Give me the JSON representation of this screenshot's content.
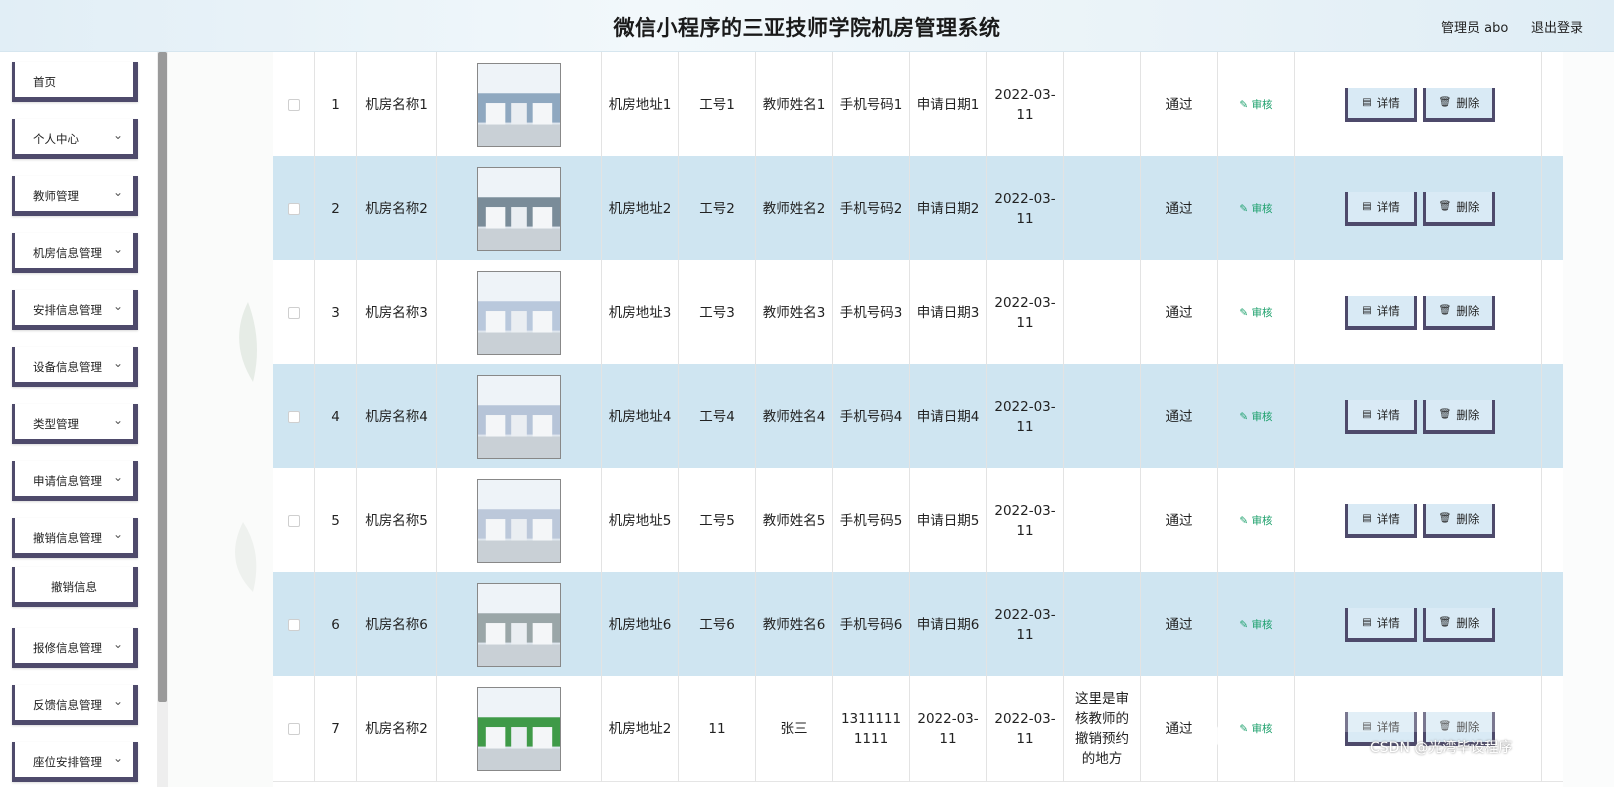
{
  "header": {
    "title": "微信小程序的三亚技师学院机房管理系统",
    "admin_label": "管理员 abo",
    "logout_label": "退出登录"
  },
  "sidebar": {
    "items": [
      {
        "label": "首页",
        "has_chevron": false
      },
      {
        "label": "个人中心",
        "has_chevron": true
      },
      {
        "label": "教师管理",
        "has_chevron": true
      },
      {
        "label": "机房信息管理",
        "has_chevron": true
      },
      {
        "label": "安排信息管理",
        "has_chevron": true
      },
      {
        "label": "设备信息管理",
        "has_chevron": true
      },
      {
        "label": "类型管理",
        "has_chevron": true
      },
      {
        "label": "申请信息管理",
        "has_chevron": true
      },
      {
        "label": "撤销信息管理",
        "has_chevron": true
      },
      {
        "label": "撤销信息",
        "has_chevron": false,
        "submenu": true
      },
      {
        "label": "报修信息管理",
        "has_chevron": true
      },
      {
        "label": "反馈信息管理",
        "has_chevron": true
      },
      {
        "label": "座位安排管理",
        "has_chevron": true
      }
    ]
  },
  "table": {
    "rows": [
      {
        "index": "1",
        "room_name": "机房名称1",
        "address": "机房地址1",
        "job_no": "工号1",
        "teacher": "教师姓名1",
        "phone": "手机号码1",
        "apply_date": "申请日期1",
        "date": "2022-03-11",
        "remark": "",
        "status": "通过",
        "photo": "lab-photo"
      },
      {
        "index": "2",
        "room_name": "机房名称2",
        "address": "机房地址2",
        "job_no": "工号2",
        "teacher": "教师姓名2",
        "phone": "手机号码2",
        "apply_date": "申请日期2",
        "date": "2022-03-11",
        "remark": "",
        "status": "通过",
        "photo": "lab-photo"
      },
      {
        "index": "3",
        "room_name": "机房名称3",
        "address": "机房地址3",
        "job_no": "工号3",
        "teacher": "教师姓名3",
        "phone": "手机号码3",
        "apply_date": "申请日期3",
        "date": "2022-03-11",
        "remark": "",
        "status": "通过",
        "photo": "lab-photo"
      },
      {
        "index": "4",
        "room_name": "机房名称4",
        "address": "机房地址4",
        "job_no": "工号4",
        "teacher": "教师姓名4",
        "phone": "手机号码4",
        "apply_date": "申请日期4",
        "date": "2022-03-11",
        "remark": "",
        "status": "通过",
        "photo": "lab-photo"
      },
      {
        "index": "5",
        "room_name": "机房名称5",
        "address": "机房地址5",
        "job_no": "工号5",
        "teacher": "教师姓名5",
        "phone": "手机号码5",
        "apply_date": "申请日期5",
        "date": "2022-03-11",
        "remark": "",
        "status": "通过",
        "photo": "lab-photo"
      },
      {
        "index": "6",
        "room_name": "机房名称6",
        "address": "机房地址6",
        "job_no": "工号6",
        "teacher": "教师姓名6",
        "phone": "手机号码6",
        "apply_date": "申请日期6",
        "date": "2022-03-11",
        "remark": "",
        "status": "通过",
        "photo": "lab-photo"
      },
      {
        "index": "7",
        "room_name": "机房名称2",
        "address": "机房地址2",
        "job_no": "11",
        "teacher": "张三",
        "phone": "13111111111",
        "apply_date": "2022-03-11",
        "date": "2022-03-11",
        "remark": "这里是审核教师的撤销预约的地方",
        "status": "通过",
        "photo": "lab-photo"
      }
    ],
    "audit_label": "审核",
    "detail_label": "详情",
    "delete_label": "删除"
  },
  "watermark": "CSDN @光湾毕设程序",
  "colors": {
    "row_alt": "#cfe5f1",
    "button_border": "#4e4a6b",
    "audit_green": "#1a9f6a"
  }
}
